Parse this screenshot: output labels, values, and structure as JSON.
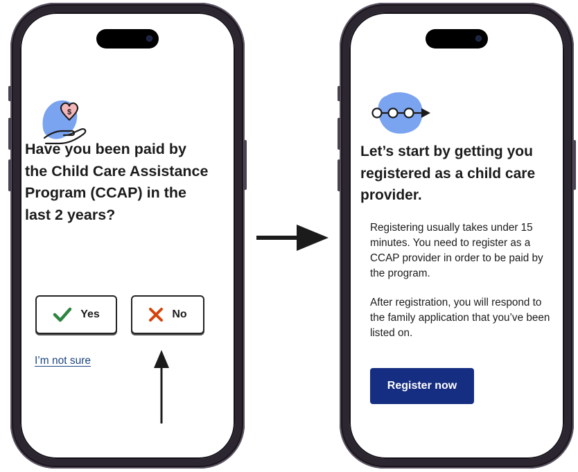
{
  "left_screen": {
    "question": "Have you  been paid by the Child Care Assistance Program (CCAP) in the last 2 years?",
    "yes_label": "Yes",
    "no_label": "No",
    "not_sure_link": "I’m not sure",
    "illustration_icon": "hand-holding-heart-dollar-icon",
    "yes_icon": "checkmark-icon",
    "no_icon": "x-icon"
  },
  "right_screen": {
    "heading": "Let’s start by getting you registered as a child care provider.",
    "paragraph_1": "Registering usually takes under 15 minutes. You need to register as a CCAP provider in order to be paid by the program.",
    "paragraph_2": "After registration, you will respond to the family application that you’ve been listed on.",
    "register_button": "Register now",
    "illustration_icon": "progress-steps-icon"
  },
  "colors": {
    "accent_blob": "#7aa3f0",
    "primary_button": "#162e81",
    "link": "#1a4480",
    "check_green": "#2e8540",
    "x_orange": "#d54309",
    "heart_pink": "#f4b6b8"
  }
}
